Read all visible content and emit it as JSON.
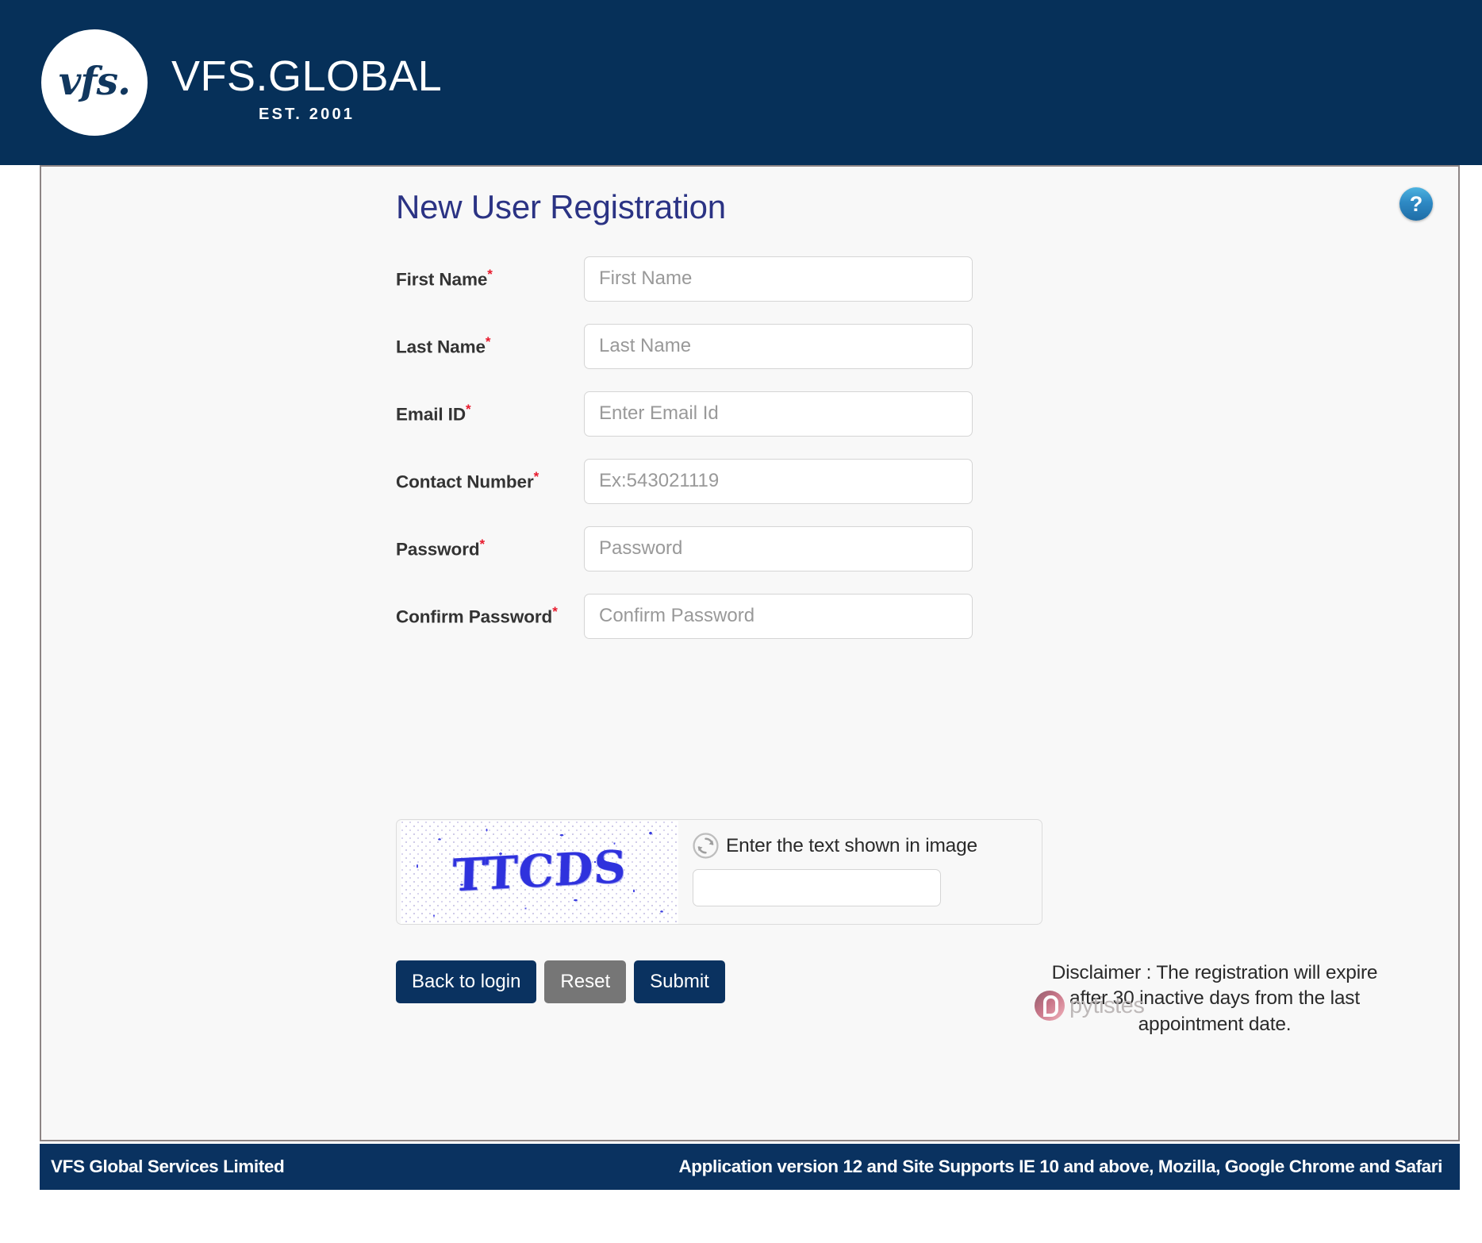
{
  "header": {
    "logo_mark": "vfs.",
    "brand_name": "VFS.GLOBAL",
    "established": "EST. 2001"
  },
  "page": {
    "title": "New User Registration",
    "help_icon_label": "?"
  },
  "form": {
    "fields": [
      {
        "label": "First Name",
        "required": "*",
        "placeholder": "First Name",
        "value": "",
        "type": "text"
      },
      {
        "label": "Last Name",
        "required": "*",
        "placeholder": "Last Name",
        "value": "",
        "type": "text"
      },
      {
        "label": "Email ID",
        "required": "*",
        "placeholder": "Enter Email Id",
        "value": "",
        "type": "text"
      },
      {
        "label": "Contact Number",
        "required": "*",
        "placeholder": "Ex:543021119",
        "value": "",
        "type": "text"
      },
      {
        "label": "Password",
        "required": "*",
        "placeholder": "Password",
        "value": "",
        "type": "password"
      },
      {
        "label": "Confirm Password",
        "required": "*",
        "placeholder": "Confirm Password",
        "value": "",
        "type": "password"
      }
    ]
  },
  "captcha": {
    "image_text": "TTCDS",
    "prompt": "Enter the text shown in image",
    "input_value": "",
    "input_placeholder": "",
    "refresh_icon": "refresh-icon"
  },
  "actions": {
    "back_to_login": "Back to login",
    "reset": "Reset",
    "submit": "Submit",
    "disclaimer": "Disclaimer : The registration will expire after 30 inactive days from the last appointment date."
  },
  "watermark": {
    "text": "pytistes"
  },
  "footer": {
    "left": "VFS Global Services Limited",
    "right": "Application version 12 and Site Supports IE 10 and above, Mozilla, Google Chrome and Safari"
  },
  "colors": {
    "navy": "#063059",
    "footer_navy": "#0a3260",
    "title_blue": "#2b3384",
    "required_red": "#e8192c",
    "reset_gray": "#767676",
    "panel_bg": "#f8f8f8",
    "captcha_blue": "#2f32dd"
  }
}
